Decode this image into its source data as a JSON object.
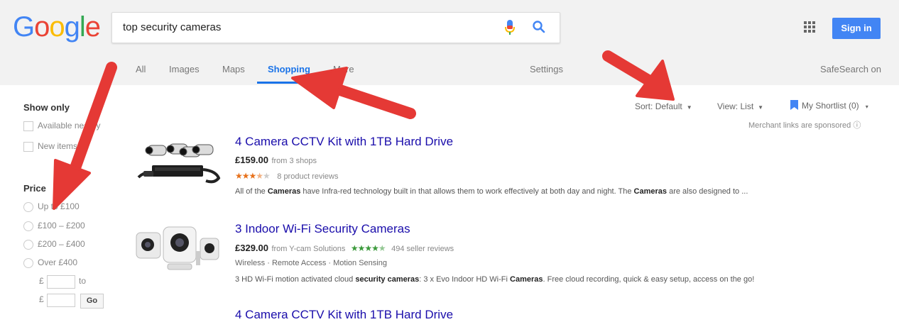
{
  "logo": {
    "letters": [
      "G",
      "o",
      "o",
      "g",
      "l",
      "e"
    ],
    "colors": [
      "#4285f4",
      "#ea4335",
      "#fbbc05",
      "#4285f4",
      "#34a853",
      "#ea4335"
    ]
  },
  "search": {
    "query": "top security cameras"
  },
  "header": {
    "sign_in": "Sign in",
    "settings": "Settings",
    "safesearch": "SafeSearch on"
  },
  "tabs": [
    {
      "label": "All"
    },
    {
      "label": "Images"
    },
    {
      "label": "Maps"
    },
    {
      "label": "Shopping",
      "active": true
    },
    {
      "label": "More"
    }
  ],
  "filters": {
    "show_only_title": "Show only",
    "show_only": [
      "Available nearby",
      "New items"
    ],
    "price_title": "Price",
    "price_options": [
      "Up to £100",
      "£100 – £200",
      "£200 – £400",
      "Over £400"
    ],
    "currency": "£",
    "to": "to",
    "go": "Go"
  },
  "toolbar": {
    "sort_label": "Sort:",
    "sort_value": "Default",
    "view_label": "View:",
    "view_value": "List",
    "shortlist": "My Shortlist (0)",
    "merchant_note": "Merchant links are sponsored ⓘ"
  },
  "results": [
    {
      "title": "4 Camera CCTV Kit with 1TB Hard Drive",
      "price": "£159.00",
      "price_source": "from 3 shops",
      "rating": 3.5,
      "reviews": "8 product reviews",
      "desc_parts": [
        "All of the ",
        "Cameras",
        " have Infra-red technology built in that allows them to work effectively at both day and night. The ",
        "Cameras",
        " are also designed to ..."
      ]
    },
    {
      "title": "3 Indoor Wi-Fi Security Cameras",
      "price": "£329.00",
      "price_source": "from Y-cam Solutions",
      "rating": 4.5,
      "reviews": "494 seller reviews",
      "features": "Wireless · Remote Access · Motion Sensing",
      "desc_parts": [
        "3 HD Wi-Fi motion activated cloud ",
        "security cameras",
        ": 3 x Evo Indoor HD Wi-Fi ",
        "Cameras",
        ". Free cloud recording, quick & easy setup, access on the go!"
      ]
    },
    {
      "title": "4 Camera CCTV Kit with 1TB Hard Drive"
    }
  ],
  "colors": {
    "link": "#1a0dab",
    "accent": "#1a73e8",
    "arrow": "#e53935",
    "star_orange": "#e7711b",
    "star_green": "#3c9a3c"
  }
}
